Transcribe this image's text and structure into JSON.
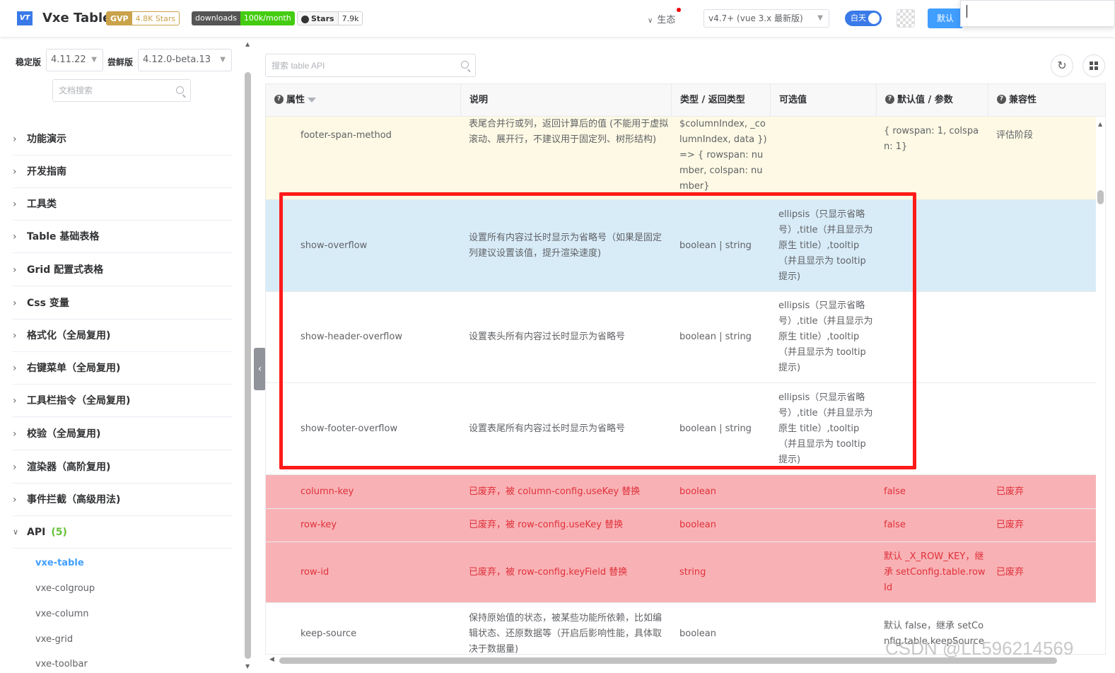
{
  "header": {
    "logo": "VT",
    "title": "Vxe Table",
    "badges": {
      "gvp_label": "GVP",
      "gvp_value": "4.8K Stars",
      "downloads_label": "downloads",
      "downloads_value": "100k/month",
      "github_label": "Stars",
      "github_value": "7.9k"
    },
    "ecosystem": "生态",
    "version_select": "v4.7+ (vue 3.x 最新版)",
    "theme_toggle": "白天",
    "default_button": "默认"
  },
  "sidebar": {
    "stable_label": "稳定版",
    "stable_version": "4.11.22",
    "beta_label": "尝鲜版",
    "beta_version": "4.12.0-beta.13",
    "search_placeholder": "文档搜索",
    "menu": [
      {
        "label": "功能演示"
      },
      {
        "label": "开发指南"
      },
      {
        "label": "工具类"
      },
      {
        "label": "Table 基础表格"
      },
      {
        "label": "Grid 配置式表格"
      },
      {
        "label": "Css 变量"
      },
      {
        "label": "格式化（全局复用)"
      },
      {
        "label": "右键菜单（全局复用)"
      },
      {
        "label": "工具栏指令（全局复用)"
      },
      {
        "label": "校验（全局复用)"
      },
      {
        "label": "渲染器（高阶复用)"
      },
      {
        "label": "事件拦截（高级用法)"
      }
    ],
    "api_label": "API",
    "api_count": "(5)",
    "api_items": [
      {
        "label": "vxe-table",
        "active": true
      },
      {
        "label": "vxe-colgroup"
      },
      {
        "label": "vxe-column"
      },
      {
        "label": "vxe-grid"
      },
      {
        "label": "vxe-toolbar"
      }
    ]
  },
  "toolbar": {
    "search_placeholder": "搜索 table API"
  },
  "table": {
    "columns": [
      "属性",
      "说明",
      "类型 / 返回类型",
      "可选值",
      "默认值 / 参数",
      "兼容性"
    ],
    "rows": [
      {
        "prop": "footer-span-method",
        "desc": "表尾合并行或列，返回计算后的值 (不能用于虚拟滚动、展开行，不建议用于固定列、树形结构)",
        "type": "$columnIndex, _columnIndex, data }) => { rowspan: number, colspan: number}",
        "options": "",
        "default": "{ rowspan: 1, colspan: 1}",
        "compat": "评估阶段"
      },
      {
        "prop": "show-overflow",
        "desc": "设置所有内容过长时显示为省略号（如果是固定列建议设置该值，提升渲染速度)",
        "type": "boolean | string",
        "options": "ellipsis（只显示省略号）,title（并且显示为原生 title）,tooltip（并且显示为 tooltip 提示)",
        "default": "",
        "compat": ""
      },
      {
        "prop": "show-header-overflow",
        "desc": "设置表头所有内容过长时显示为省略号",
        "type": "boolean | string",
        "options": "ellipsis（只显示省略号）,title（并且显示为原生 title）,tooltip（并且显示为 tooltip 提示)",
        "default": "",
        "compat": ""
      },
      {
        "prop": "show-footer-overflow",
        "desc": "设置表尾所有内容过长时显示为省略号",
        "type": "boolean | string",
        "options": "ellipsis（只显示省略号）,title（并且显示为原生 title）,tooltip（并且显示为 tooltip 提示)",
        "default": "",
        "compat": ""
      },
      {
        "prop": "column-key",
        "desc": "已废弃，被 column-config.useKey 替换",
        "type": "boolean",
        "options": "",
        "default": "false",
        "compat": "已废弃"
      },
      {
        "prop": "row-key",
        "desc": "已废弃，被 row-config.useKey 替换",
        "type": "boolean",
        "options": "",
        "default": "false",
        "compat": "已废弃"
      },
      {
        "prop": "row-id",
        "desc": "已废弃，被 row-config.keyField 替换",
        "type": "string",
        "options": "",
        "default": "默认 _X_ROW_KEY，继承 setConfig.table.rowId",
        "compat": "已废弃"
      },
      {
        "prop": "keep-source",
        "desc": "保持原始值的状态，被某些功能所依赖，比如编辑状态、还原数据等（开启后影响性能，具体取决于数据量)",
        "type": "boolean",
        "options": "",
        "default": "默认 false，继承 setConfig.table.keepSource",
        "compat": ""
      }
    ]
  },
  "watermark": "CSDN @LL5962145​69",
  "colors": {
    "accent": "#409eff",
    "deprecated_row": "#f8b2b5",
    "highlight_row": "#d8ecf8",
    "evaluating_row": "#fdf9e4",
    "annotation_box": "#ff1a1a"
  }
}
